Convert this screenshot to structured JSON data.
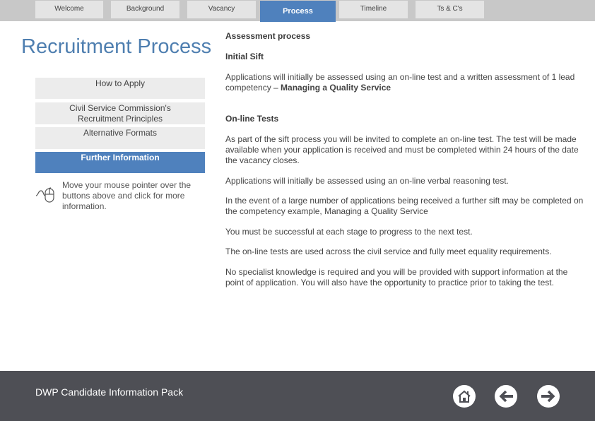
{
  "nav": {
    "tabs": [
      {
        "label": "Welcome",
        "active": false
      },
      {
        "label": "Background",
        "active": false
      },
      {
        "label": "Vacancy",
        "active": false
      },
      {
        "label": "Process",
        "active": true
      },
      {
        "label": "Timeline",
        "active": false
      },
      {
        "label": "Ts & C's",
        "active": false
      }
    ]
  },
  "page": {
    "title": "Recruitment Process"
  },
  "sidebar": {
    "buttons": [
      {
        "label": "How to Apply"
      },
      {
        "label": "Civil Service Commission's Recruitment Principles"
      },
      {
        "label": "Alternative Formats"
      },
      {
        "label": "Further Information",
        "active": true
      }
    ],
    "hint_icon": "mouse-icon",
    "hint": "Move your mouse pointer over the buttons above and click for more information."
  },
  "content": {
    "heading": "Assessment process",
    "initial_sift": {
      "heading": "Initial Sift",
      "text": "Applications will initially be assessed using an on-line test and a written assessment of 1 lead competency – ",
      "bold": "Managing a Quality Service"
    },
    "online_tests": {
      "heading": "On-line Tests",
      "paragraphs": [
        "As part of the sift process you will be invited to complete an on-line test. The test will be made available when your application is received and must be completed within 24 hours of the date the vacancy closes.",
        "Applications will initially be assessed using an on-line verbal reasoning test.",
        "In the event of a large number of applications being received a further sift may be completed on the competency example, Managing a Quality Service",
        "You must be successful at each stage to progress to the next test.",
        "The on-line tests are used across the civil service and fully meet equality requirements.",
        "No specialist knowledge is required and you will be provided with support information at the point of application. You will also have the opportunity to practice prior to taking the test."
      ]
    }
  },
  "footer": {
    "title": "DWP Candidate Information Pack",
    "buttons": [
      {
        "icon": "home-icon",
        "label": "Home"
      },
      {
        "icon": "arrow-left-icon",
        "label": "Previous"
      },
      {
        "icon": "arrow-right-icon",
        "label": "Next"
      }
    ]
  },
  "colors": {
    "accent": "#4f81bd",
    "title": "#4f7fb0",
    "footer_bg": "#4e4f55",
    "tab_bg": "#e4e4e4",
    "topbar_bg": "#c8c8c8"
  }
}
